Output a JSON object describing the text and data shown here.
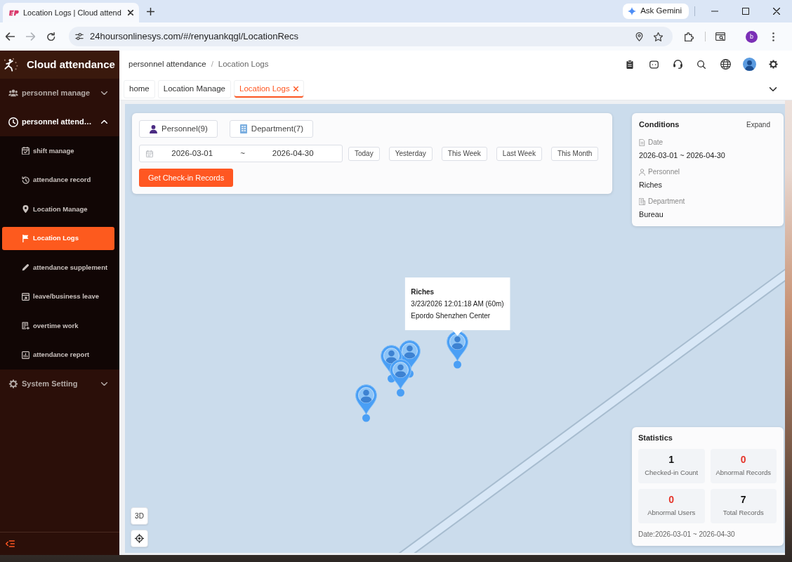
{
  "browser": {
    "tab_title": "Location Logs | Cloud attend",
    "gemini": "Ask Gemini",
    "back_disabled": false,
    "forward_disabled": true,
    "url": "24hoursonlinesys.com/#/renyuankqgl/LocationRecs",
    "profile_initial": "b"
  },
  "sidebar": {
    "title": "Cloud attendance",
    "menus": [
      {
        "label": "personnel manage",
        "expanded": false
      },
      {
        "label": "personnel attend…",
        "expanded": true,
        "children": [
          {
            "label": "shift manage",
            "selected": false
          },
          {
            "label": "attendance record",
            "selected": false
          },
          {
            "label": "Location Manage",
            "selected": false
          },
          {
            "label": "Location Logs",
            "selected": true
          },
          {
            "label": "attendance supplement",
            "selected": false
          },
          {
            "label": "leave/business leave",
            "selected": false
          },
          {
            "label": "overtime work",
            "selected": false
          },
          {
            "label": "attendance report",
            "selected": false
          }
        ]
      },
      {
        "label": "System Setting",
        "expanded": false
      }
    ]
  },
  "breadcrumb": {
    "items": [
      "personnel attendance",
      "Location Logs"
    ],
    "separator": "/"
  },
  "tabs": [
    {
      "label": "home",
      "selected": false,
      "closable": false
    },
    {
      "label": "Location Manage",
      "selected": false,
      "closable": false
    },
    {
      "label": "Location Logs",
      "selected": true,
      "closable": true
    }
  ],
  "filter": {
    "personnel": "Personnel(9)",
    "department": "Department(7)",
    "date_start": "2026-03-01",
    "date_separator": "~",
    "date_end": "2026-04-30",
    "quick_ranges": [
      "Today",
      "Yesterday",
      "This Week",
      "Last Week",
      "This Month"
    ],
    "submit": "Get Check-in Records"
  },
  "conditions": {
    "title": "Conditions",
    "toggle": "Expand",
    "fields": [
      {
        "label": "Date",
        "value": "2026-03-01 ~ 2026-04-30"
      },
      {
        "label": "Personnel",
        "value": "Riches"
      },
      {
        "label": "Department",
        "value": "Bureau"
      }
    ]
  },
  "map": {
    "markers": [
      {
        "selected": false
      },
      {
        "selected": false
      },
      {
        "selected": false
      },
      {
        "selected": false
      },
      {
        "selected": true
      }
    ],
    "popup": {
      "name": "Riches",
      "time": "3/23/2026 12:01:18 AM (60m)",
      "place": "Epordo Shenzhen Center"
    },
    "view_button": "3D"
  },
  "statistics": {
    "title": "Statistics",
    "items": [
      {
        "value": "1",
        "label": "Checked-in Count",
        "color": "#111111"
      },
      {
        "value": "0",
        "label": "Abnormal Records",
        "color": "#e5352b"
      },
      {
        "value": "0",
        "label": "Abnormal Users",
        "color": "#e5352b"
      },
      {
        "value": "7",
        "label": "Total Records",
        "color": "#111111"
      }
    ],
    "footer": "Date:2026-03-01 ~ 2026-04-30"
  }
}
